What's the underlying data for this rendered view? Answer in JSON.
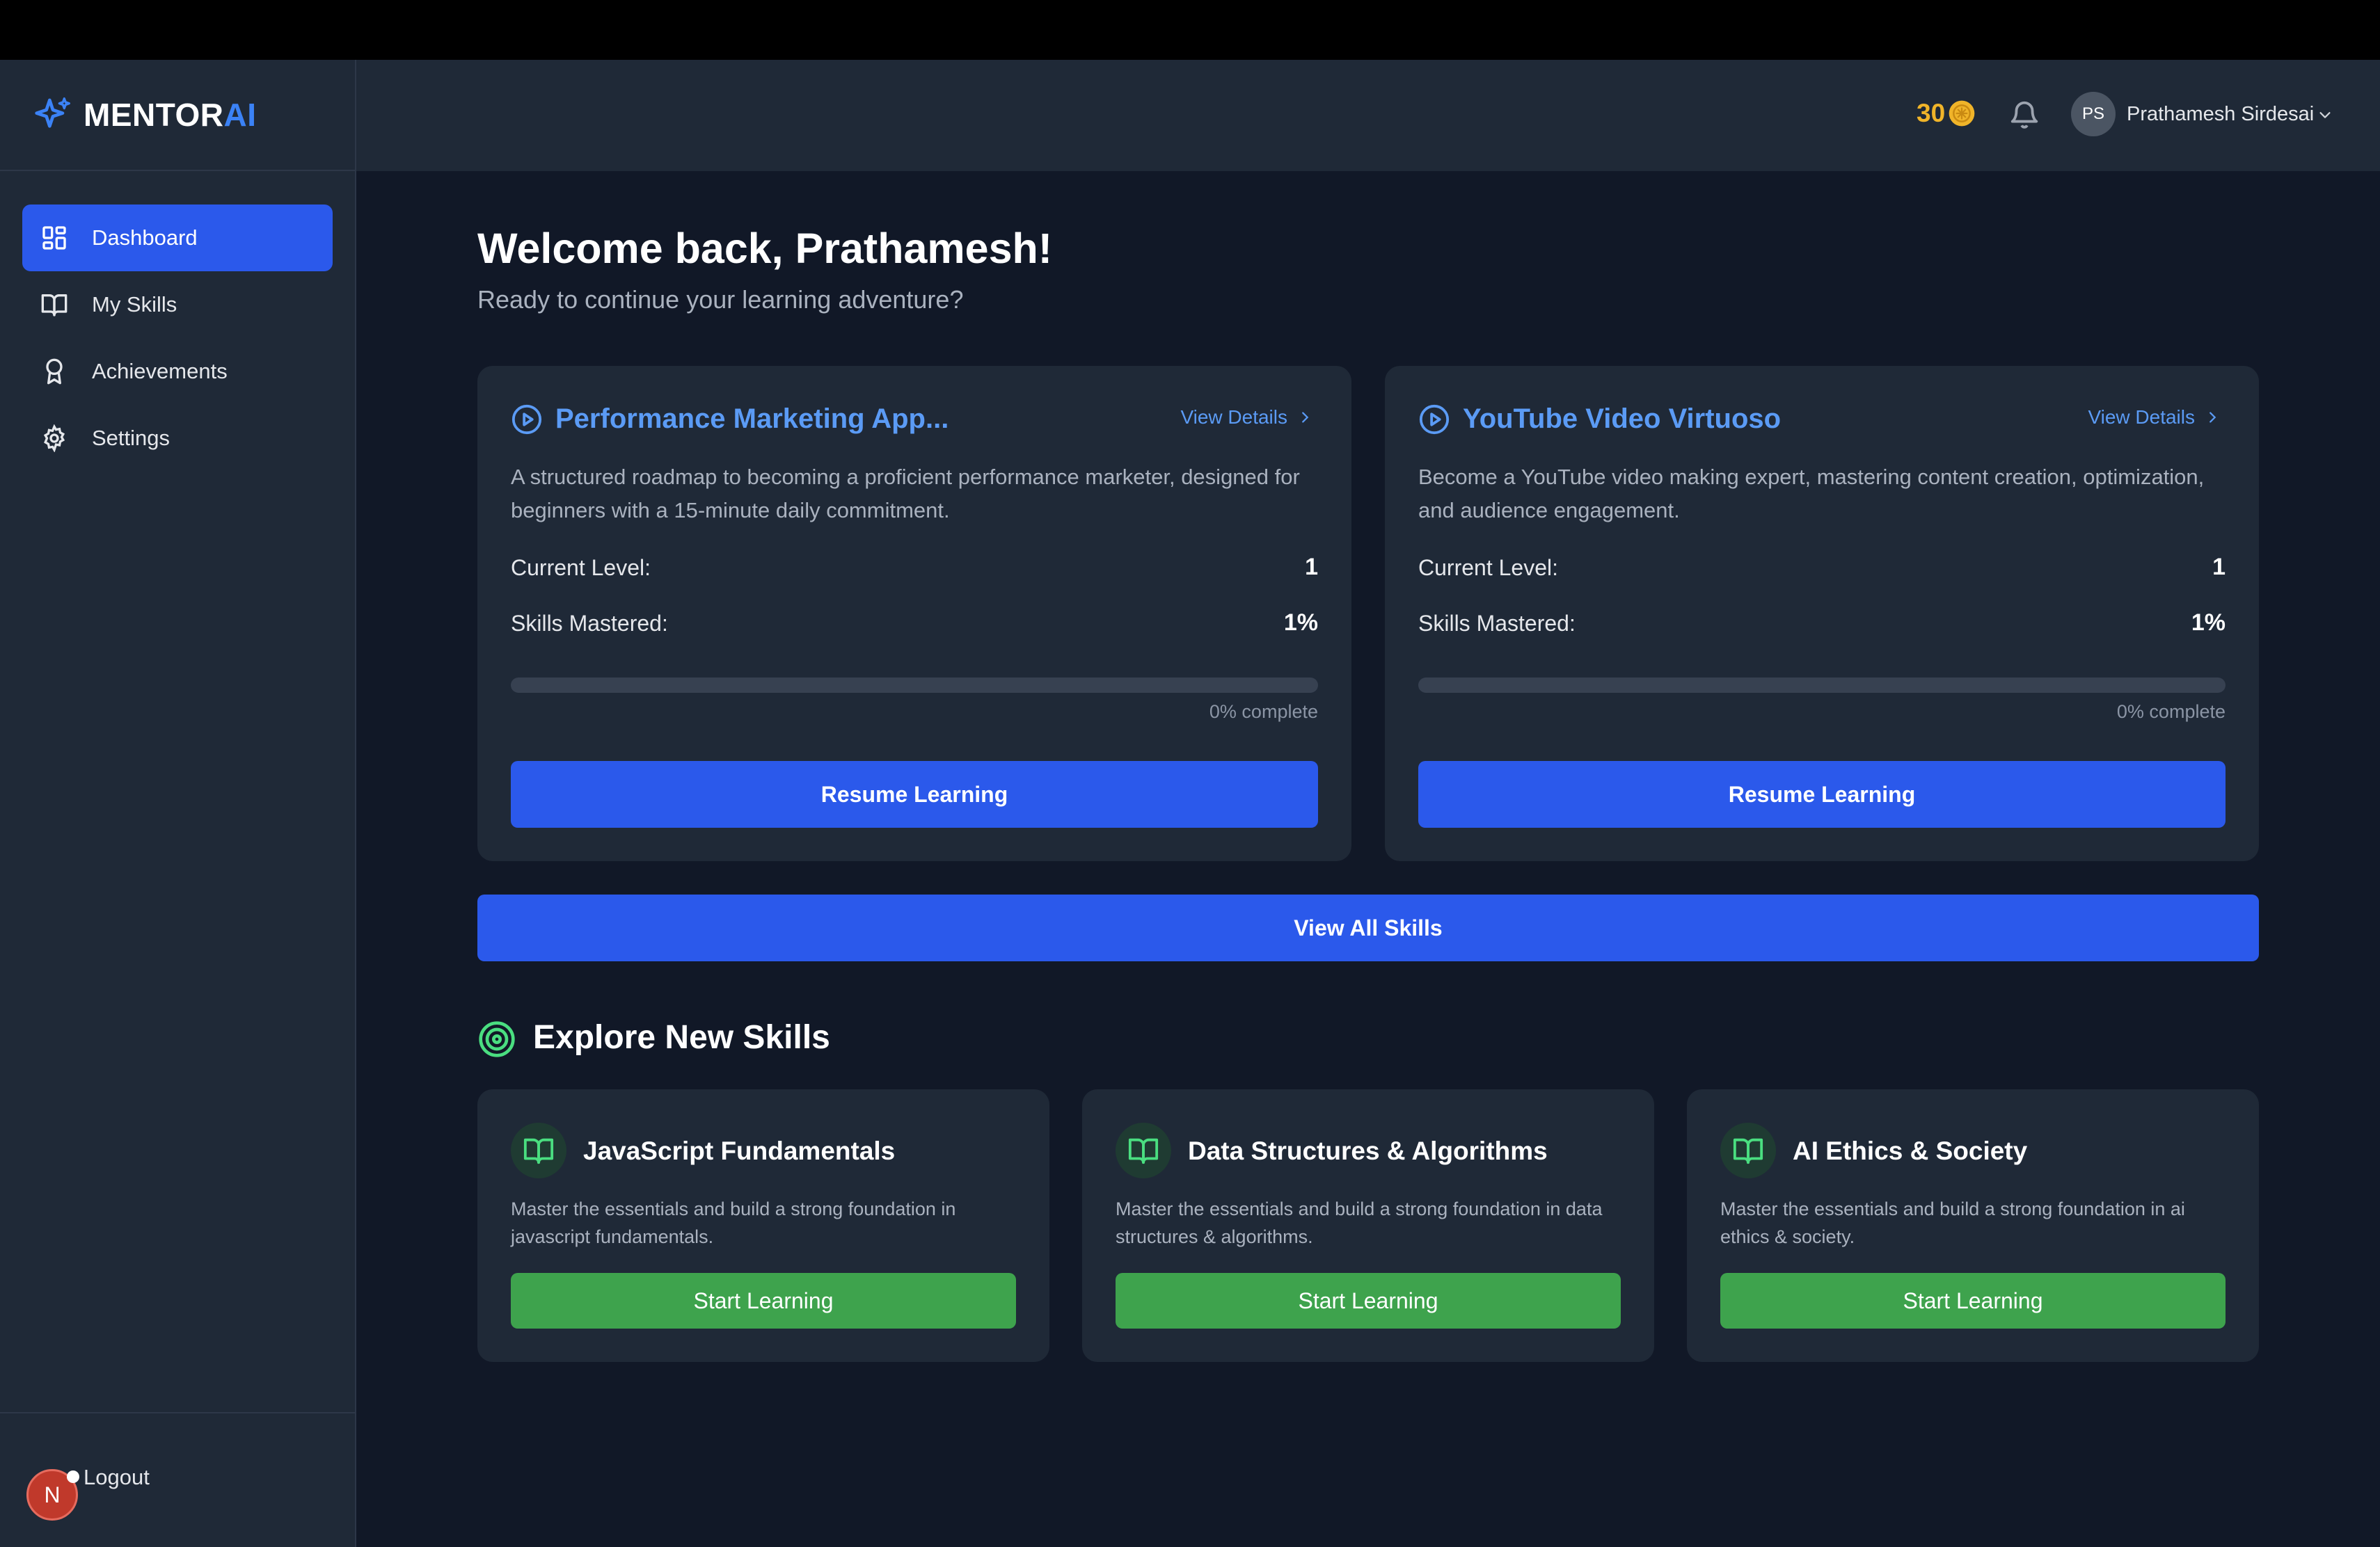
{
  "brand": {
    "name_main": "MENTOR",
    "name_accent": "AI"
  },
  "sidebar": {
    "items": [
      {
        "label": "Dashboard",
        "icon": "dashboard-icon",
        "active": true
      },
      {
        "label": "My Skills",
        "icon": "book-icon",
        "active": false
      },
      {
        "label": "Achievements",
        "icon": "award-icon",
        "active": false
      },
      {
        "label": "Settings",
        "icon": "gear-icon",
        "active": false
      }
    ],
    "logout_label": "Logout",
    "badge_letter": "N"
  },
  "header": {
    "coins": "30",
    "avatar_initials": "PS",
    "user_name": "Prathamesh Sirdesai"
  },
  "main": {
    "welcome_title": "Welcome back, Prathamesh!",
    "welcome_subtitle": "Ready to continue your learning adventure?",
    "skill_cards": [
      {
        "title": "Performance Marketing App...",
        "view_details": "View Details",
        "description": "A structured roadmap to becoming a proficient performance marketer, designed for beginners with a 15-minute daily commitment.",
        "level_label": "Current Level:",
        "level_value": "1",
        "mastered_label": "Skills Mastered:",
        "mastered_value": "1%",
        "progress_text": "0% complete",
        "progress": 0,
        "button": "Resume Learning"
      },
      {
        "title": "YouTube Video Virtuoso",
        "view_details": "View Details",
        "description": "Become a YouTube video making expert, mastering content creation, optimization, and audience engagement.",
        "level_label": "Current Level:",
        "level_value": "1",
        "mastered_label": "Skills Mastered:",
        "mastered_value": "1%",
        "progress_text": "0% complete",
        "progress": 0,
        "button": "Resume Learning"
      }
    ],
    "view_all_label": "View All Skills",
    "explore_title": "Explore New Skills",
    "new_skills": [
      {
        "title": "JavaScript Fundamentals",
        "description": "Master the essentials and build a strong foundation in javascript fundamentals.",
        "button": "Start Learning"
      },
      {
        "title": "Data Structures & Algorithms",
        "description": "Master the essentials and build a strong foundation in data structures & algorithms.",
        "button": "Start Learning"
      },
      {
        "title": "AI Ethics & Society",
        "description": "Master the essentials and build a strong foundation in ai ethics & society.",
        "button": "Start Learning"
      }
    ]
  },
  "colors": {
    "background": "#111827",
    "panel": "#1f2937",
    "primary": "#2b59eb",
    "accent_text": "#5b9bf5",
    "success": "#3ea34d",
    "coin": "#f0b429"
  }
}
